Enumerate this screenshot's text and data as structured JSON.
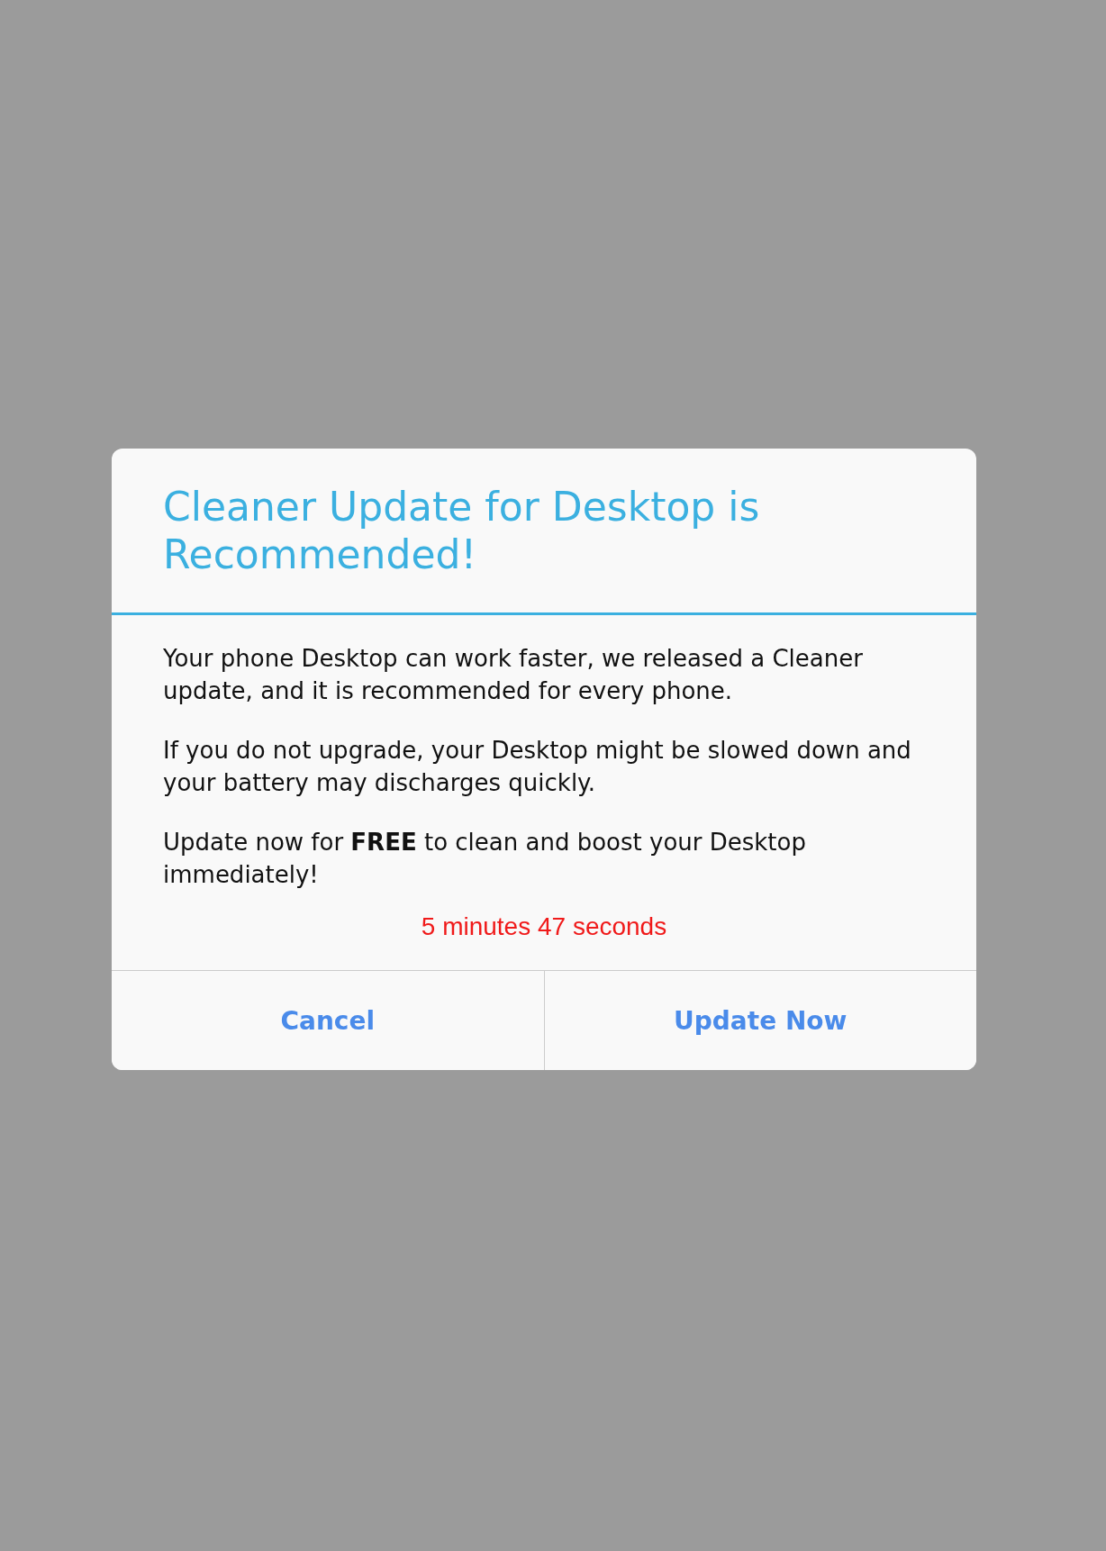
{
  "dialog": {
    "title": "Cleaner Update for Desktop is Recommended!",
    "paragraphs": [
      "Your phone Desktop can work faster, we released a Cleaner update, and it is recommended for every phone.",
      "If you do not upgrade, your Desktop might be slowed down and your battery may discharges quickly.",
      "Update now for **FREE** to clean and boost your Desktop immediately!"
    ],
    "countdown": "5 minutes 47 seconds",
    "buttons": [
      "Cancel",
      "Update Now"
    ]
  }
}
